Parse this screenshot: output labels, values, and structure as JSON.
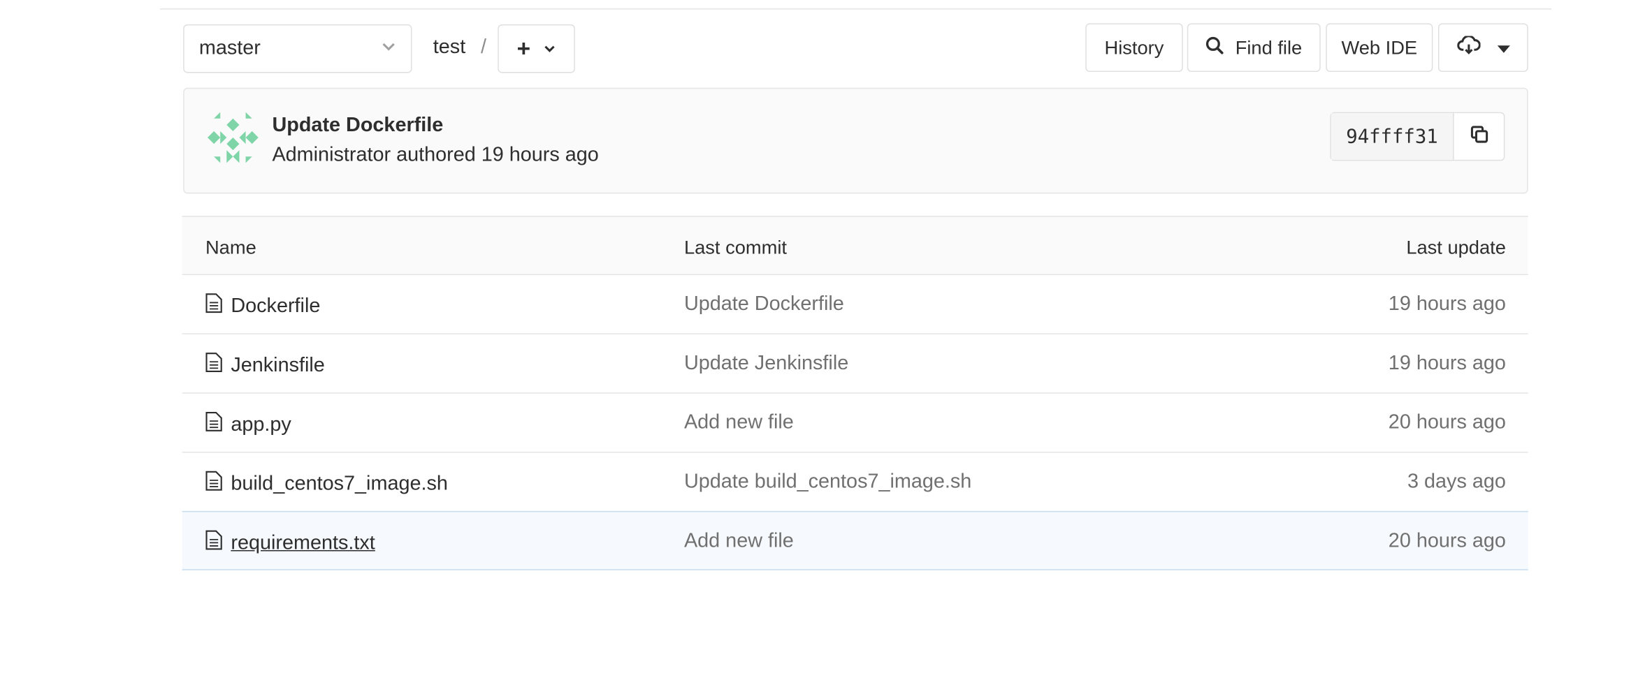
{
  "repo_nav": {
    "branch": "master",
    "path": "test",
    "path_separator": "/",
    "add_symbol": "+",
    "history_label": "History",
    "find_file_label": "Find file",
    "web_ide_label": "Web IDE"
  },
  "last_commit": {
    "title": "Update Dockerfile",
    "meta": "Administrator authored 19 hours ago",
    "sha": "94ffff31"
  },
  "table": {
    "headers": {
      "name": "Name",
      "last_commit": "Last commit",
      "last_update": "Last update"
    },
    "rows": [
      {
        "name": "Dockerfile",
        "commit": "Update Dockerfile",
        "updated": "19 hours ago"
      },
      {
        "name": "Jenkinsfile",
        "commit": "Update Jenkinsfile",
        "updated": "19 hours ago"
      },
      {
        "name": "app.py",
        "commit": "Add new file",
        "updated": "20 hours ago"
      },
      {
        "name": "build_centos7_image.sh",
        "commit": "Update build_centos7_image.sh",
        "updated": "3 days ago"
      },
      {
        "name": "requirements.txt",
        "commit": "Add new file",
        "updated": "20 hours ago"
      }
    ]
  },
  "icons": {
    "branch_dropdown": "chevron-down-icon",
    "add_dropdown": "chevron-down-icon",
    "find_file": "search-icon",
    "download": "cloud-download-icon",
    "copy_sha": "copy-icon",
    "file": "file-icon",
    "avatar": "identicon"
  },
  "colors": {
    "avatar_green": "#7fd4a8",
    "hover_row_bg": "#f6fafe",
    "hover_row_border": "#c8dcef",
    "muted_text": "#707070"
  }
}
